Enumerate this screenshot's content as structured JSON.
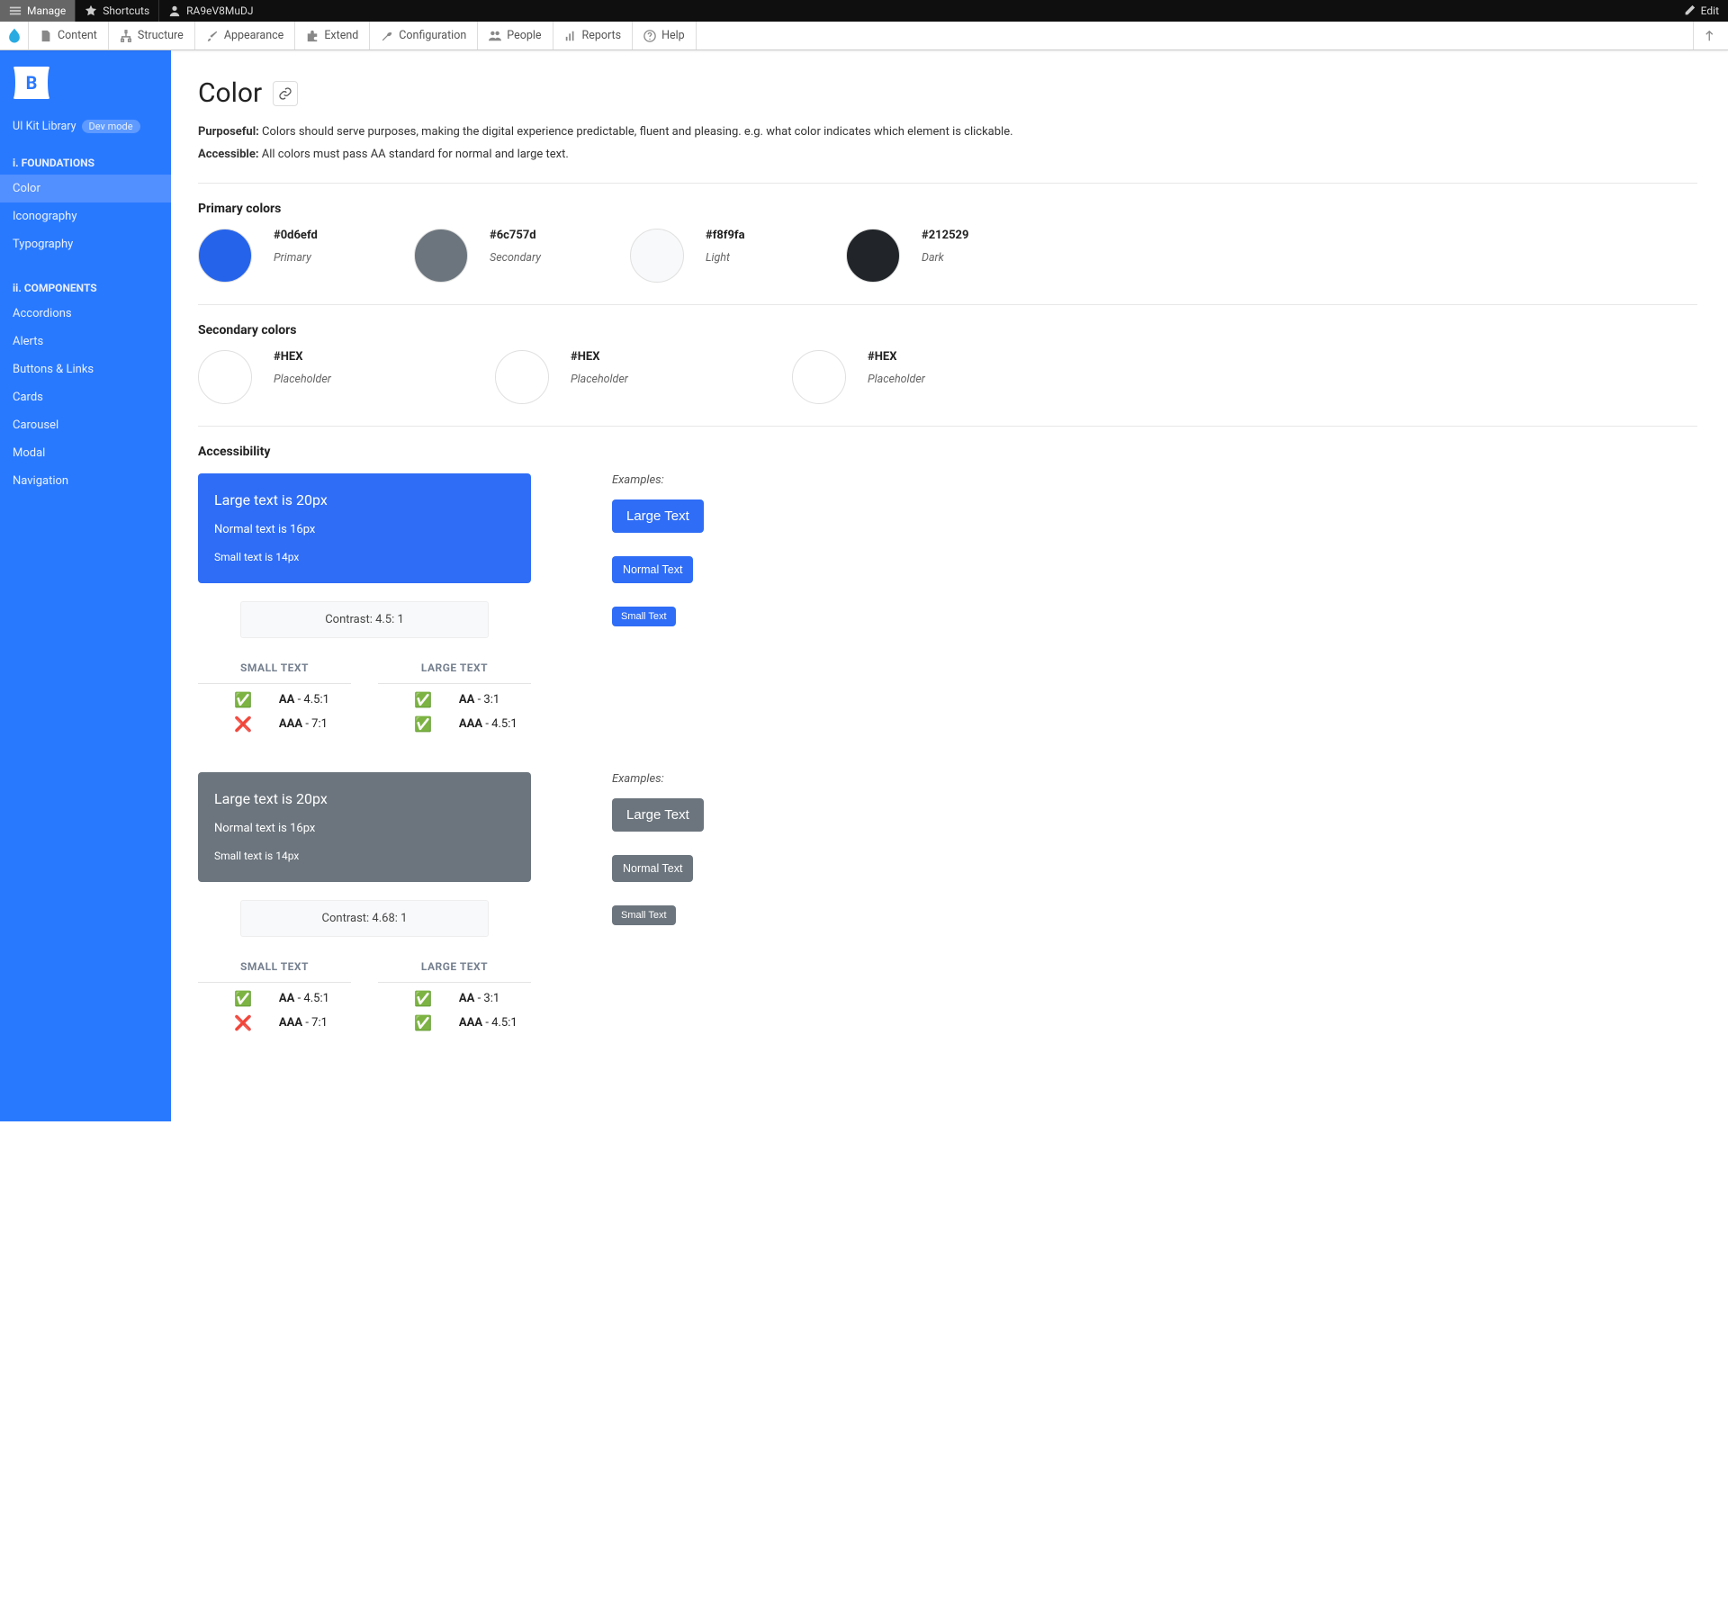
{
  "adminbar": {
    "manage": "Manage",
    "shortcuts": "Shortcuts",
    "user": "RA9eV8MuDJ",
    "edit": "Edit"
  },
  "menubar": {
    "items": [
      "Content",
      "Structure",
      "Appearance",
      "Extend",
      "Configuration",
      "People",
      "Reports",
      "Help"
    ]
  },
  "sidebar": {
    "library": "UI Kit Library",
    "badge": "Dev mode",
    "section1": "i. FOUNDATIONS",
    "foundations": [
      "Color",
      "Iconography",
      "Typography"
    ],
    "section2": "ii. COMPONENTS",
    "components": [
      "Accordions",
      "Alerts",
      "Buttons & Links",
      "Cards",
      "Carousel",
      "Modal",
      "Navigation"
    ]
  },
  "page": {
    "title": "Color",
    "purposeful_label": "Purposeful:",
    "purposeful_text": " Colors should serve purposes, making the digital experience predictable, fluent and pleasing. e.g. what color indicates which element is clickable.",
    "accessible_label": "Accessible:",
    "accessible_text": " All colors must pass AA standard for normal and large text."
  },
  "primary": {
    "heading": "Primary colors",
    "items": [
      {
        "hex": "#0d6efd",
        "role": "Primary",
        "color": "#2563eb"
      },
      {
        "hex": "#6c757d",
        "role": "Secondary",
        "color": "#6c757d"
      },
      {
        "hex": "#f8f9fa",
        "role": "Light",
        "color": "#f8f9fa"
      },
      {
        "hex": "#212529",
        "role": "Dark",
        "color": "#212529"
      }
    ]
  },
  "secondary": {
    "heading": "Secondary colors",
    "items": [
      {
        "hex": "#HEX",
        "role": "Placeholder"
      },
      {
        "hex": "#HEX",
        "role": "Placeholder"
      },
      {
        "hex": "#HEX",
        "role": "Placeholder"
      }
    ]
  },
  "accessibility": {
    "heading": "Accessibility",
    "large": "Large text is 20px",
    "normal": "Normal text is 16px",
    "small": "Small text is 14px",
    "examples": "Examples:",
    "btn_large": "Large Text",
    "btn_normal": "Normal Text",
    "btn_small": "Small Text",
    "contrast1": "Contrast: 4.5: 1",
    "contrast2": "Contrast: 4.68: 1",
    "col_small": "SMALL TEXT",
    "col_large": "LARGE TEXT",
    "rows_small": [
      {
        "mark": "✅",
        "label": "AA",
        "ratio": " - 4.5:1"
      },
      {
        "mark": "❌",
        "label": "AAA",
        "ratio": " - 7:1"
      }
    ],
    "rows_large": [
      {
        "mark": "✅",
        "label": "AA",
        "ratio": " - 3:1"
      },
      {
        "mark": "✅",
        "label": "AAA",
        "ratio": " - 4.5:1"
      }
    ]
  }
}
